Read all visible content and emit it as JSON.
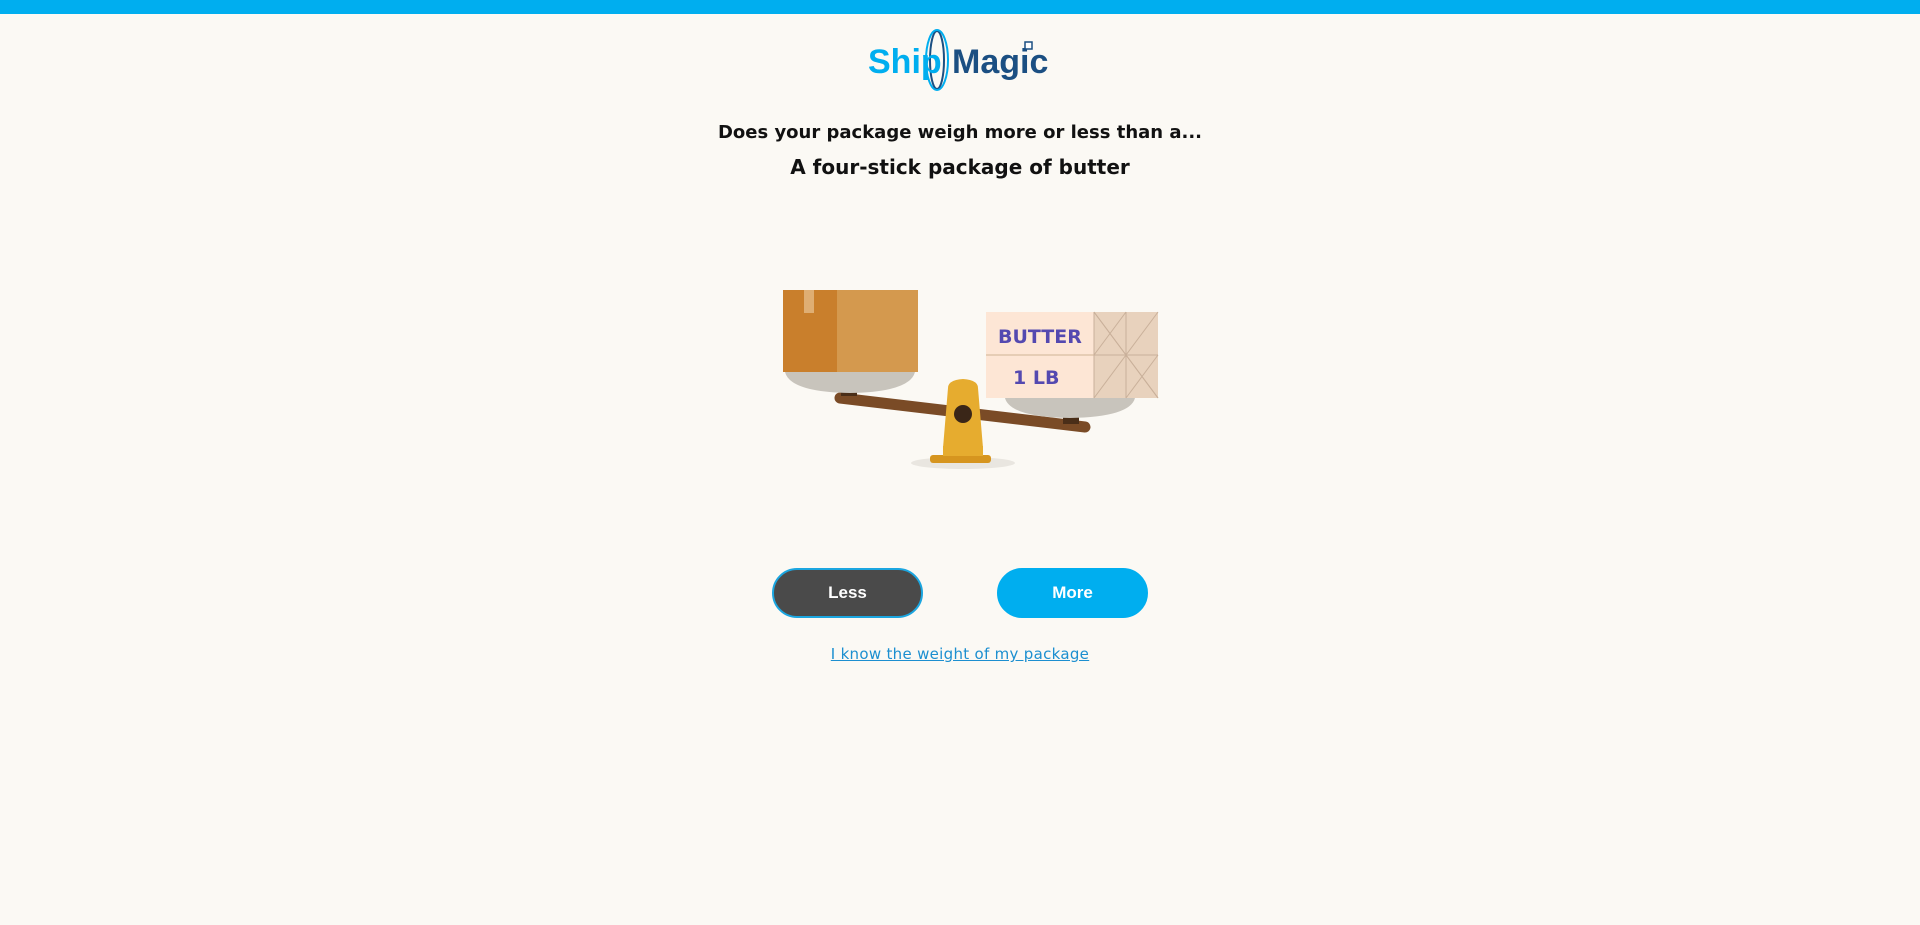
{
  "brand": {
    "name_part1": "Ship",
    "name_part2": "Magic",
    "color_light": "#00aeef",
    "color_dark": "#1b4f82"
  },
  "accent_color": "#00aeef",
  "question": "Does your package weigh more or less than a...",
  "comparison_item": "A four-stick package of butter",
  "illustration": {
    "butter_line1": "BUTTER",
    "butter_line2": "1 LB"
  },
  "buttons": {
    "less_label": "Less",
    "more_label": "More"
  },
  "know_weight_link": "I know the weight of my package"
}
